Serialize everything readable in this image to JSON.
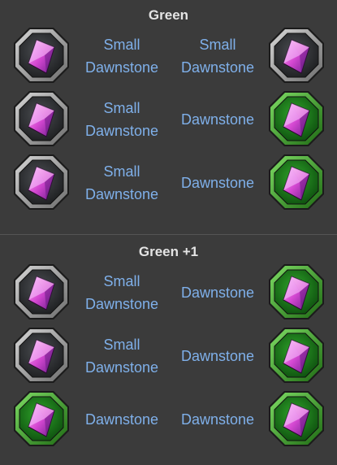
{
  "sections": [
    {
      "title": "Green",
      "rows": [
        {
          "from": {
            "label": "Small Dawnstone",
            "icon": "small-dawnstone-icon",
            "frame": "grey"
          },
          "to": {
            "label": "Small Dawnstone",
            "icon": "small-dawnstone-icon",
            "frame": "grey"
          }
        },
        {
          "from": {
            "label": "Small Dawnstone",
            "icon": "small-dawnstone-icon",
            "frame": "grey"
          },
          "to": {
            "label": "Dawnstone",
            "icon": "dawnstone-icon",
            "frame": "green"
          }
        },
        {
          "from": {
            "label": "Small Dawnstone",
            "icon": "small-dawnstone-icon",
            "frame": "grey"
          },
          "to": {
            "label": "Dawnstone",
            "icon": "dawnstone-icon",
            "frame": "green"
          }
        }
      ]
    },
    {
      "title": "Green +1",
      "rows": [
        {
          "from": {
            "label": "Small Dawnstone",
            "icon": "small-dawnstone-icon",
            "frame": "grey"
          },
          "to": {
            "label": "Dawnstone",
            "icon": "dawnstone-icon",
            "frame": "green"
          }
        },
        {
          "from": {
            "label": "Small Dawnstone",
            "icon": "small-dawnstone-icon",
            "frame": "grey"
          },
          "to": {
            "label": "Dawnstone",
            "icon": "dawnstone-icon",
            "frame": "green"
          }
        },
        {
          "from": {
            "label": "Dawnstone",
            "icon": "dawnstone-icon",
            "frame": "green"
          },
          "to": {
            "label": "Dawnstone",
            "icon": "dawnstone-icon",
            "frame": "green"
          }
        }
      ]
    }
  ],
  "colors": {
    "background": "#3b3b3b",
    "title": "#e4e4e4",
    "label": "#7fb0ea",
    "frame_grey": "#8a8a8a",
    "frame_green": "#2e8c22",
    "gem": "#d548d2"
  }
}
